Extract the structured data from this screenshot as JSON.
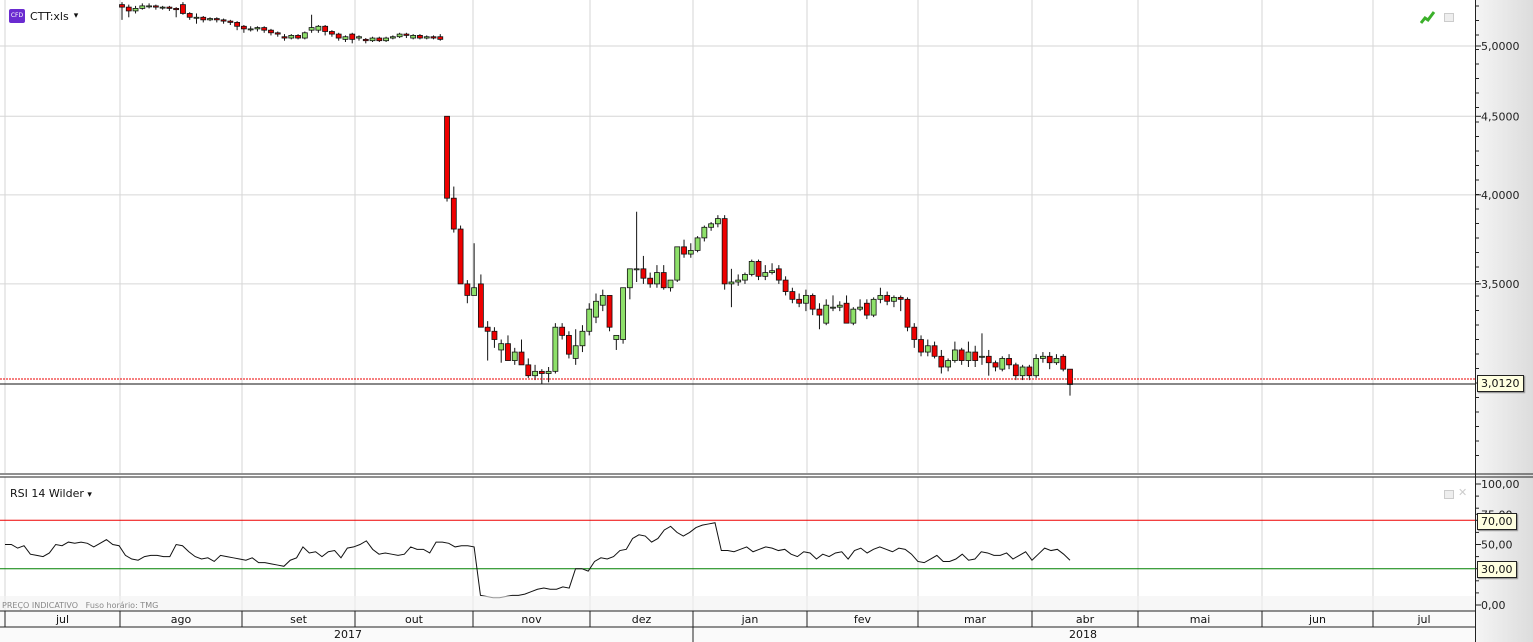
{
  "legend": {
    "symbol": "CTT:xls",
    "badge": "CFD",
    "caret": "▾"
  },
  "rsi_legend": {
    "label": "RSI 14 Wilder",
    "caret": "▾"
  },
  "footer_note": "PREÇO INDICATIVO   Fuso horário: TMG",
  "icons": {
    "chart_type": "green-line-chart-icon",
    "minimize": "minimize-icon",
    "close": "close-icon"
  },
  "colors": {
    "up": "#8ee06a",
    "down": "#ee0000",
    "rsi_upper": "#ee0000",
    "rsi_lower": "#008000",
    "last_price": "#ee0000"
  },
  "chart_data": [
    {
      "type": "candlestick",
      "scale": "log",
      "ylim": [
        2.62,
        5.36
      ],
      "yticks": [
        "5,0000",
        "4,5000",
        "4,0000",
        "3,5000"
      ],
      "ytick_values": [
        5,
        4.5,
        4,
        3.5
      ],
      "last_price_label": "3,0120",
      "last_price": 3.012,
      "months": [
        "jul",
        "ago",
        "set",
        "out",
        "nov",
        "dez",
        "jan",
        "fev",
        "mar",
        "abr",
        "mai",
        "jun",
        "jul"
      ],
      "years": [
        "2017",
        "2018"
      ],
      "candles": [
        [
          5.32,
          5.34,
          5.2,
          5.3
        ],
        [
          5.3,
          5.32,
          5.22,
          5.27
        ],
        [
          5.27,
          5.31,
          5.25,
          5.29
        ],
        [
          5.29,
          5.33,
          5.28,
          5.31
        ],
        [
          5.31,
          5.33,
          5.29,
          5.31
        ],
        [
          5.31,
          5.32,
          5.28,
          5.3
        ],
        [
          5.3,
          5.31,
          5.28,
          5.3
        ],
        [
          5.3,
          5.31,
          5.27,
          5.29
        ],
        [
          5.29,
          5.3,
          5.22,
          5.28
        ],
        [
          5.32,
          5.34,
          5.24,
          5.25
        ],
        [
          5.25,
          5.26,
          5.2,
          5.22
        ],
        [
          5.22,
          5.25,
          5.17,
          5.22
        ],
        [
          5.22,
          5.23,
          5.18,
          5.2
        ],
        [
          5.2,
          5.22,
          5.19,
          5.21
        ],
        [
          5.21,
          5.22,
          5.18,
          5.2
        ],
        [
          5.2,
          5.21,
          5.17,
          5.19
        ],
        [
          5.19,
          5.2,
          5.16,
          5.18
        ],
        [
          5.18,
          5.19,
          5.12,
          5.15
        ],
        [
          5.15,
          5.16,
          5.1,
          5.13
        ],
        [
          5.13,
          5.15,
          5.11,
          5.13
        ],
        [
          5.13,
          5.15,
          5.11,
          5.14
        ],
        [
          5.14,
          5.15,
          5.1,
          5.12
        ],
        [
          5.12,
          5.13,
          5.08,
          5.1
        ],
        [
          5.1,
          5.11,
          5.07,
          5.09
        ],
        [
          5.07,
          5.09,
          5.04,
          5.06
        ],
        [
          5.06,
          5.09,
          5.05,
          5.08
        ],
        [
          5.08,
          5.09,
          5.05,
          5.06
        ],
        [
          5.06,
          5.11,
          5.05,
          5.1
        ],
        [
          5.12,
          5.24,
          5.1,
          5.14
        ],
        [
          5.12,
          5.16,
          5.1,
          5.15
        ],
        [
          5.15,
          5.16,
          5.08,
          5.11
        ],
        [
          5.11,
          5.12,
          5.07,
          5.09
        ],
        [
          5.09,
          5.1,
          5.04,
          5.06
        ],
        [
          5.05,
          5.08,
          5.03,
          5.07
        ],
        [
          5.09,
          5.1,
          5.02,
          5.05
        ],
        [
          5.06,
          5.08,
          5.04,
          5.07
        ],
        [
          5.05,
          5.06,
          5.02,
          5.04
        ],
        [
          5.04,
          5.07,
          5.03,
          5.06
        ],
        [
          5.06,
          5.07,
          5.03,
          5.04
        ],
        [
          5.04,
          5.07,
          5.03,
          5.06
        ],
        [
          5.06,
          5.08,
          5.05,
          5.07
        ],
        [
          5.07,
          5.1,
          5.06,
          5.09
        ],
        [
          5.09,
          5.1,
          5.06,
          5.08
        ],
        [
          5.06,
          5.09,
          5.05,
          5.08
        ],
        [
          5.08,
          5.09,
          5.05,
          5.06
        ],
        [
          5.06,
          5.08,
          5.05,
          5.07
        ],
        [
          5.07,
          5.08,
          5.05,
          5.06
        ],
        [
          5.07,
          5.09,
          5.04,
          5.05
        ],
        [
          4.5,
          4.5,
          3.96,
          3.98
        ],
        [
          3.98,
          4.05,
          3.78,
          3.8
        ],
        [
          3.8,
          3.82,
          3.5,
          3.5
        ],
        [
          3.5,
          3.52,
          3.4,
          3.44
        ],
        [
          3.44,
          3.72,
          3.44,
          3.48
        ],
        [
          3.5,
          3.55,
          3.3,
          3.28
        ],
        [
          3.28,
          3.31,
          3.12,
          3.26
        ],
        [
          3.26,
          3.28,
          3.18,
          3.22
        ],
        [
          3.17,
          3.22,
          3.11,
          3.2
        ],
        [
          3.2,
          3.24,
          3.12,
          3.12
        ],
        [
          3.12,
          3.18,
          3.1,
          3.16
        ],
        [
          3.16,
          3.22,
          3.1,
          3.1
        ],
        [
          3.1,
          3.13,
          3.04,
          3.05
        ],
        [
          3.05,
          3.1,
          3.03,
          3.07
        ],
        [
          3.07,
          3.08,
          3.01,
          3.06
        ],
        [
          3.06,
          3.09,
          3.02,
          3.07
        ],
        [
          3.07,
          3.3,
          3.06,
          3.28
        ],
        [
          3.28,
          3.3,
          3.22,
          3.24
        ],
        [
          3.24,
          3.26,
          3.13,
          3.15
        ],
        [
          3.13,
          3.27,
          3.1,
          3.19
        ],
        [
          3.19,
          3.29,
          3.16,
          3.26
        ],
        [
          3.26,
          3.4,
          3.24,
          3.37
        ],
        [
          3.33,
          3.45,
          3.3,
          3.41
        ],
        [
          3.39,
          3.47,
          3.36,
          3.44
        ],
        [
          3.44,
          3.44,
          3.26,
          3.28
        ],
        [
          3.22,
          3.24,
          3.17,
          3.24
        ],
        [
          3.22,
          3.47,
          3.2,
          3.48
        ],
        [
          3.48,
          3.5,
          3.42,
          3.58
        ],
        [
          3.58,
          3.9,
          3.51,
          3.58
        ],
        [
          3.58,
          3.65,
          3.5,
          3.53
        ],
        [
          3.53,
          3.56,
          3.48,
          3.5
        ],
        [
          3.5,
          3.6,
          3.48,
          3.56
        ],
        [
          3.56,
          3.6,
          3.47,
          3.48
        ],
        [
          3.48,
          3.52,
          3.46,
          3.52
        ],
        [
          3.52,
          3.7,
          3.51,
          3.7
        ],
        [
          3.7,
          3.74,
          3.64,
          3.66
        ],
        [
          3.66,
          3.72,
          3.64,
          3.68
        ],
        [
          3.68,
          3.76,
          3.67,
          3.75
        ],
        [
          3.75,
          3.82,
          3.73,
          3.81
        ],
        [
          3.81,
          3.84,
          3.79,
          3.83
        ],
        [
          3.83,
          3.88,
          3.81,
          3.86
        ],
        [
          3.86,
          3.88,
          3.47,
          3.5
        ],
        [
          3.5,
          3.58,
          3.38,
          3.51
        ],
        [
          3.51,
          3.55,
          3.49,
          3.52
        ],
        [
          3.52,
          3.56,
          3.5,
          3.55
        ],
        [
          3.55,
          3.63,
          3.54,
          3.62
        ],
        [
          3.62,
          3.63,
          3.52,
          3.54
        ],
        [
          3.54,
          3.6,
          3.52,
          3.56
        ],
        [
          3.56,
          3.61,
          3.55,
          3.57
        ],
        [
          3.58,
          3.6,
          3.5,
          3.52
        ],
        [
          3.52,
          3.54,
          3.44,
          3.46
        ],
        [
          3.46,
          3.48,
          3.4,
          3.42
        ],
        [
          3.42,
          3.45,
          3.38,
          3.4
        ],
        [
          3.4,
          3.47,
          3.36,
          3.44
        ],
        [
          3.44,
          3.45,
          3.34,
          3.37
        ],
        [
          3.37,
          3.4,
          3.27,
          3.34
        ],
        [
          3.3,
          3.42,
          3.29,
          3.39
        ],
        [
          3.38,
          3.44,
          3.36,
          3.38
        ],
        [
          3.38,
          3.41,
          3.36,
          3.39
        ],
        [
          3.4,
          3.44,
          3.3,
          3.3
        ],
        [
          3.3,
          3.38,
          3.29,
          3.37
        ],
        [
          3.37,
          3.42,
          3.36,
          3.38
        ],
        [
          3.4,
          3.42,
          3.32,
          3.34
        ],
        [
          3.34,
          3.43,
          3.33,
          3.42
        ],
        [
          3.42,
          3.48,
          3.4,
          3.44
        ],
        [
          3.44,
          3.46,
          3.39,
          3.41
        ],
        [
          3.41,
          3.44,
          3.38,
          3.43
        ],
        [
          3.43,
          3.44,
          3.36,
          3.42
        ],
        [
          3.42,
          3.43,
          3.26,
          3.28
        ],
        [
          3.28,
          3.3,
          3.18,
          3.22
        ],
        [
          3.22,
          3.24,
          3.14,
          3.16
        ],
        [
          3.16,
          3.22,
          3.14,
          3.19
        ],
        [
          3.19,
          3.21,
          3.13,
          3.14
        ],
        [
          3.14,
          3.17,
          3.06,
          3.09
        ],
        [
          3.09,
          3.13,
          3.07,
          3.12
        ],
        [
          3.12,
          3.21,
          3.11,
          3.17
        ],
        [
          3.17,
          3.18,
          3.1,
          3.12
        ],
        [
          3.12,
          3.21,
          3.09,
          3.16
        ],
        [
          3.16,
          3.19,
          3.09,
          3.12
        ],
        [
          3.14,
          3.25,
          3.1,
          3.14
        ],
        [
          3.14,
          3.17,
          3.05,
          3.11
        ],
        [
          3.11,
          3.12,
          3.07,
          3.09
        ],
        [
          3.08,
          3.14,
          3.07,
          3.13
        ],
        [
          3.13,
          3.15,
          3.08,
          3.1
        ],
        [
          3.1,
          3.11,
          3.03,
          3.05
        ],
        [
          3.05,
          3.1,
          3.03,
          3.09
        ],
        [
          3.09,
          3.1,
          3.03,
          3.05
        ],
        [
          3.05,
          3.15,
          3.04,
          3.13
        ],
        [
          3.13,
          3.16,
          3.11,
          3.14
        ],
        [
          3.14,
          3.16,
          3.08,
          3.11
        ],
        [
          3.11,
          3.15,
          3.1,
          3.13
        ],
        [
          3.14,
          3.15,
          3.07,
          3.08
        ],
        [
          3.08,
          3.08,
          2.96,
          3.01
        ]
      ]
    },
    {
      "type": "line",
      "name": "RSI 14 Wilder",
      "ylim": [
        0,
        100
      ],
      "yticks": [
        "100,00",
        "75,00",
        "50,00",
        "0,00"
      ],
      "ytick_values": [
        100,
        75,
        50,
        0
      ],
      "levels": [
        {
          "value": 70,
          "label": "70,00"
        },
        {
          "value": 30,
          "label": "30,00"
        }
      ],
      "values": [
        50,
        50,
        47,
        49,
        42,
        41,
        40,
        43,
        50,
        49,
        52,
        51,
        52,
        51,
        48,
        51,
        54,
        50,
        49,
        41,
        38,
        37,
        40,
        41,
        41,
        40,
        40,
        50,
        49,
        44,
        40,
        38,
        39,
        36,
        41,
        40,
        39,
        38,
        37,
        39,
        35,
        35,
        34,
        33,
        32,
        37,
        39,
        48,
        43,
        44,
        40,
        44,
        45,
        39,
        47,
        48,
        50,
        53,
        46,
        42,
        43,
        42,
        41,
        42,
        48,
        46,
        46,
        43,
        52,
        52,
        51,
        48,
        49,
        49,
        48,
        8,
        7,
        6,
        6,
        7,
        8,
        8,
        9,
        11,
        13,
        14,
        13,
        13,
        15,
        14,
        30,
        30,
        28,
        36,
        39,
        38,
        40,
        45,
        46,
        55,
        58,
        57,
        52,
        55,
        62,
        65,
        60,
        57,
        60,
        64,
        66,
        67,
        68,
        45,
        45,
        44,
        46,
        48,
        44,
        46,
        48,
        47,
        45,
        46,
        42,
        40,
        44,
        43,
        38,
        42,
        40,
        43,
        44,
        38,
        45,
        47,
        43,
        46,
        48,
        46,
        44,
        47,
        46,
        42,
        36,
        35,
        38,
        41,
        36,
        36,
        38,
        42,
        37,
        38,
        44,
        43,
        41,
        41,
        43,
        38,
        41,
        44,
        37,
        42,
        47,
        45,
        46,
        42,
        37
      ]
    }
  ]
}
